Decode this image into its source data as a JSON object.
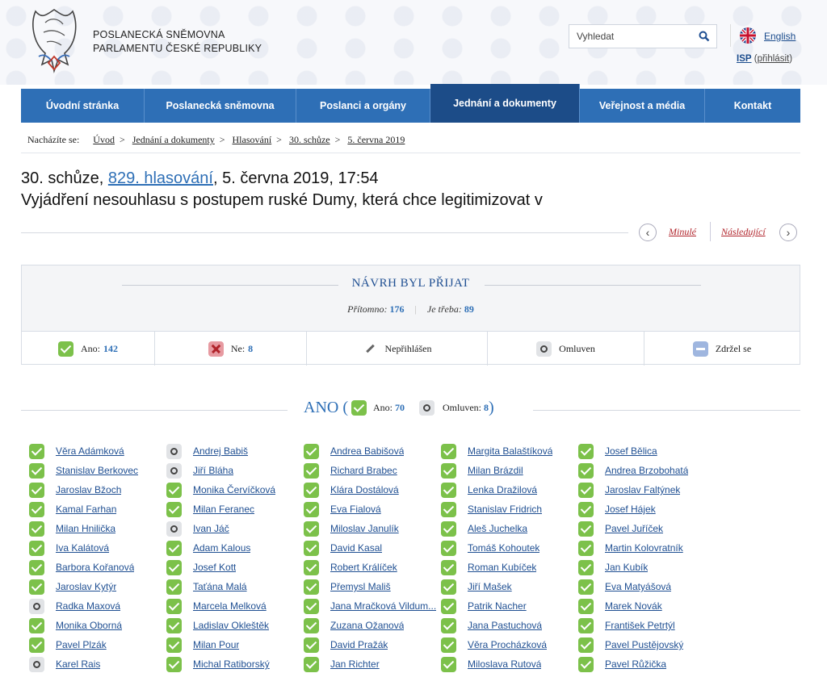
{
  "header": {
    "institution_line1": "POSLANECKÁ SNĚMOVNA",
    "institution_line2": "PARLAMENTU ČESKÉ REPUBLIKY",
    "search_placeholder": "Vyhledat",
    "english_label": "English",
    "isp_label": "ISP",
    "isp_login": "přihlásit"
  },
  "nav": [
    {
      "label": "Úvodní stránka",
      "active": false
    },
    {
      "label": "Poslanecká sněmovna",
      "active": false
    },
    {
      "label": "Poslanci a orgány",
      "active": false
    },
    {
      "label": "Jednání a dokumenty",
      "active": true
    },
    {
      "label": "Veřejnost a média",
      "active": false
    },
    {
      "label": "Kontakt",
      "active": false
    }
  ],
  "breadcrumb": {
    "prefix": "Nacházíte se:",
    "items": [
      "Úvod",
      "Jednání a dokumenty",
      "Hlasování",
      "30. schůze",
      "5. června 2019"
    ]
  },
  "title": {
    "session": "30. schůze,",
    "vote_link": "829. hlasování",
    "date_time": ", 5. června 2019, 17:54",
    "subject": "Vyjádření nesouhlasu s postupem ruské Dumy, která chce legitimizovat v"
  },
  "pager": {
    "prev": "Minulé",
    "next": "Následující"
  },
  "result": {
    "verdict": "NÁVRH BYL PŘIJAT",
    "present_label": "Přítomno:",
    "present_value": "176",
    "required_label": "Je třeba:",
    "required_value": "89",
    "yes_label": "Ano:",
    "yes_value": "142",
    "no_label": "Ne:",
    "no_value": "8",
    "not_logged": "Nepřihlášen",
    "excused": "Omluven",
    "abstained": "Zdržel se"
  },
  "party": {
    "name": "ANO (",
    "close": ")",
    "yes_label": "Ano:",
    "yes_value": "70",
    "excused_label": "Omluven:",
    "excused_value": "8"
  },
  "members": [
    [
      {
        "n": "Věra Adámková",
        "v": "yes"
      },
      {
        "n": "Andrej Babiš",
        "v": "exc"
      },
      {
        "n": "Andrea Babišová",
        "v": "yes"
      },
      {
        "n": "Margita Balaštíková",
        "v": "yes"
      },
      {
        "n": "Josef Bělica",
        "v": "yes"
      }
    ],
    [
      {
        "n": "Stanislav Berkovec",
        "v": "yes"
      },
      {
        "n": "Jiří Bláha",
        "v": "exc"
      },
      {
        "n": "Richard Brabec",
        "v": "yes"
      },
      {
        "n": "Milan Brázdil",
        "v": "yes"
      },
      {
        "n": "Andrea Brzobohatá",
        "v": "yes"
      }
    ],
    [
      {
        "n": "Jaroslav Bžoch",
        "v": "yes"
      },
      {
        "n": "Monika Červíčková",
        "v": "yes"
      },
      {
        "n": "Klára Dostálová",
        "v": "yes"
      },
      {
        "n": "Lenka Dražilová",
        "v": "yes"
      },
      {
        "n": "Jaroslav Faltýnek",
        "v": "yes"
      }
    ],
    [
      {
        "n": "Kamal Farhan",
        "v": "yes"
      },
      {
        "n": "Milan Feranec",
        "v": "yes"
      },
      {
        "n": "Eva Fialová",
        "v": "yes"
      },
      {
        "n": "Stanislav Fridrich",
        "v": "yes"
      },
      {
        "n": "Josef Hájek",
        "v": "yes"
      }
    ],
    [
      {
        "n": "Milan Hnilička",
        "v": "yes"
      },
      {
        "n": "Ivan Jáč",
        "v": "exc"
      },
      {
        "n": "Miloslav Janulík",
        "v": "yes"
      },
      {
        "n": "Aleš Juchelka",
        "v": "yes"
      },
      {
        "n": "Pavel Juříček",
        "v": "yes"
      }
    ],
    [
      {
        "n": "Iva Kalátová",
        "v": "yes"
      },
      {
        "n": "Adam Kalous",
        "v": "yes"
      },
      {
        "n": "David Kasal",
        "v": "yes"
      },
      {
        "n": "Tomáš Kohoutek",
        "v": "yes"
      },
      {
        "n": "Martin Kolovratník",
        "v": "yes"
      }
    ],
    [
      {
        "n": "Barbora Kořanová",
        "v": "yes"
      },
      {
        "n": "Josef Kott",
        "v": "yes"
      },
      {
        "n": "Robert Králíček",
        "v": "yes"
      },
      {
        "n": "Roman Kubíček",
        "v": "yes"
      },
      {
        "n": "Jan Kubík",
        "v": "yes"
      }
    ],
    [
      {
        "n": "Jaroslav Kytýr",
        "v": "yes"
      },
      {
        "n": "Taťána Malá",
        "v": "yes"
      },
      {
        "n": "Přemysl Mališ",
        "v": "yes"
      },
      {
        "n": "Jiří Mašek",
        "v": "yes"
      },
      {
        "n": "Eva Matyášová",
        "v": "yes"
      }
    ],
    [
      {
        "n": "Radka Maxová",
        "v": "exc"
      },
      {
        "n": "Marcela Melková",
        "v": "yes"
      },
      {
        "n": "Jana Mračková Vildum...",
        "v": "yes"
      },
      {
        "n": "Patrik Nacher",
        "v": "yes"
      },
      {
        "n": "Marek Novák",
        "v": "yes"
      }
    ],
    [
      {
        "n": "Monika Oborná",
        "v": "yes"
      },
      {
        "n": "Ladislav Okleštěk",
        "v": "yes"
      },
      {
        "n": "Zuzana Ožanová",
        "v": "yes"
      },
      {
        "n": "Jana Pastuchová",
        "v": "yes"
      },
      {
        "n": "František Petrtýl",
        "v": "yes"
      }
    ],
    [
      {
        "n": "Pavel Plzák",
        "v": "yes"
      },
      {
        "n": "Milan Pour",
        "v": "yes"
      },
      {
        "n": "David Pražák",
        "v": "yes"
      },
      {
        "n": "Věra Procházková",
        "v": "yes"
      },
      {
        "n": "Pavel Pustějovský",
        "v": "yes"
      }
    ],
    [
      {
        "n": "Karel Rais",
        "v": "exc"
      },
      {
        "n": "Michal Ratiborský",
        "v": "yes"
      },
      {
        "n": "Jan Richter",
        "v": "yes"
      },
      {
        "n": "Miloslava Rutová",
        "v": "yes"
      },
      {
        "n": "Pavel Růžička",
        "v": "yes"
      }
    ]
  ],
  "colors": {
    "nav": "#2e6fb6",
    "nav_active": "#1c4c88",
    "link": "#1f4f92",
    "accent_red": "#b0232a",
    "yes_green": "#7cc14a"
  }
}
